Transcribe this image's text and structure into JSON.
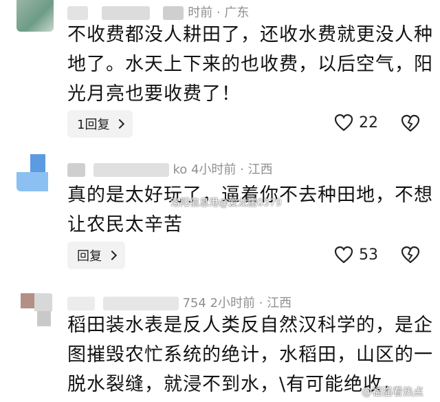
{
  "comments": [
    {
      "meta_suffix": "时前 · 广东",
      "lines": [
        "不收费都没人耕田了，还收水费就更没人种",
        "地了。水天上下来的也收费，以后空气，阳",
        "光月亮也要收费了！"
      ],
      "reply_label": "1回复",
      "likes": "22"
    },
    {
      "meta_suffix": "ko  4小时前 · 江西",
      "lines": [
        "真的是太好玩了，逼着你不去种田地，不想",
        "让农民太辛苦"
      ],
      "reply_label": "回复",
      "likes": "53"
    },
    {
      "meta_suffix": "754  2小时前 · 江西",
      "lines": [
        "稻田装水表是反人类反自然汉科学的，是企",
        "图摧毁农忙系统的绝计，水稻田，山区的一",
        "脱水裂缝，就浸不到水，\\有可能绝收，"
      ]
    }
  ],
  "watermark_center": "洛阳信息港@爱龙崖0379",
  "watermark_corner": "@福猫看热点",
  "icons": {
    "like": "heart-outline-icon",
    "dislike": "broken-heart-icon",
    "reply_arrow": "chevron-right-icon"
  }
}
